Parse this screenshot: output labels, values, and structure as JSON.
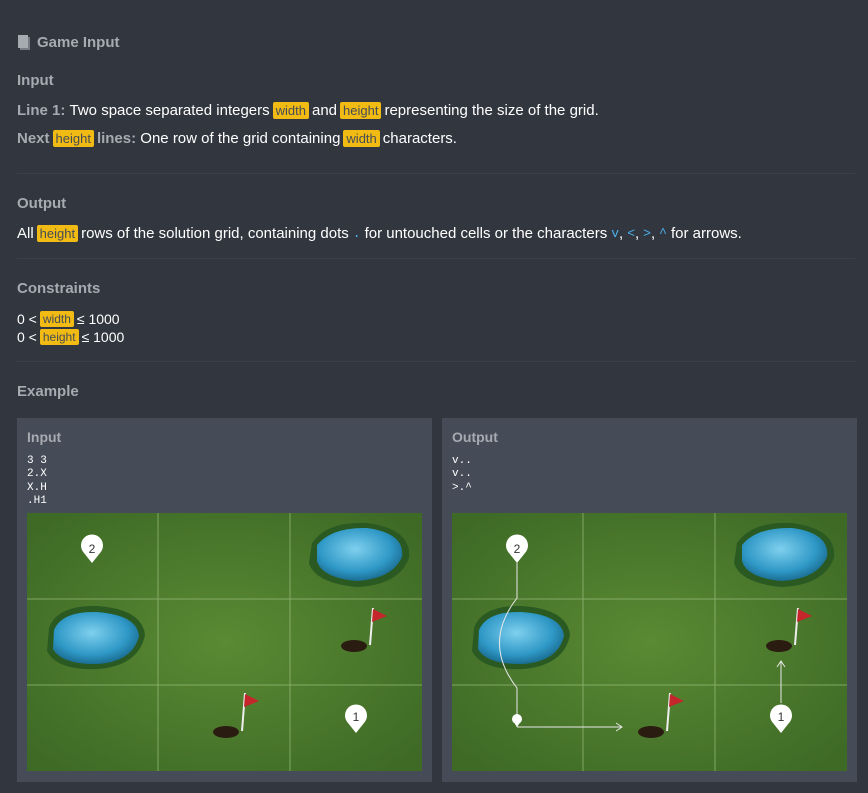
{
  "header": {
    "title": "Game Input",
    "icon": "document-icon"
  },
  "input_section": {
    "title": "Input",
    "line1": {
      "label": "Line 1:",
      "t1": "Two space separated integers",
      "v1": "width",
      "t2": "and",
      "v2": "height",
      "t3": "representing the size of the grid."
    },
    "line2": {
      "l1": "Next",
      "v1": "height",
      "l2": "lines:",
      "t1": "One row of the grid containing",
      "v2": "width",
      "t2": "characters."
    }
  },
  "output_section": {
    "title": "Output",
    "line": {
      "t1": "All",
      "v1": "height",
      "t2": "rows of the solution grid, containing dots",
      "c1": ".",
      "t3": "for untouched cells or the characters",
      "c2": "v",
      "c3": "<",
      "c4": ">",
      "c5": "^",
      "sep": ",",
      "t4": "for arrows."
    }
  },
  "constraints": {
    "title": "Constraints",
    "rows": [
      {
        "pre": "0 <",
        "var": "width",
        "post": "≤ 1000"
      },
      {
        "pre": "0 <",
        "var": "height",
        "post": "≤ 1000"
      }
    ]
  },
  "example": {
    "title": "Example",
    "input_panel": {
      "title": "Input",
      "lines": [
        "3 3",
        "2.X",
        "X.H",
        ".H1"
      ]
    },
    "output_panel": {
      "title": "Output",
      "lines": [
        "v..",
        "v..",
        ">.^"
      ]
    },
    "ball_labels": {
      "two": "2",
      "one": "1"
    }
  },
  "colors": {
    "background": "#32363f",
    "panel": "#454c57",
    "muted": "#a7aab1",
    "variable": "#f2bb13",
    "code": "#4ab3ee",
    "grass": "#4d7a2c",
    "water": "#3a9fc9",
    "flag": "#c4262b"
  }
}
